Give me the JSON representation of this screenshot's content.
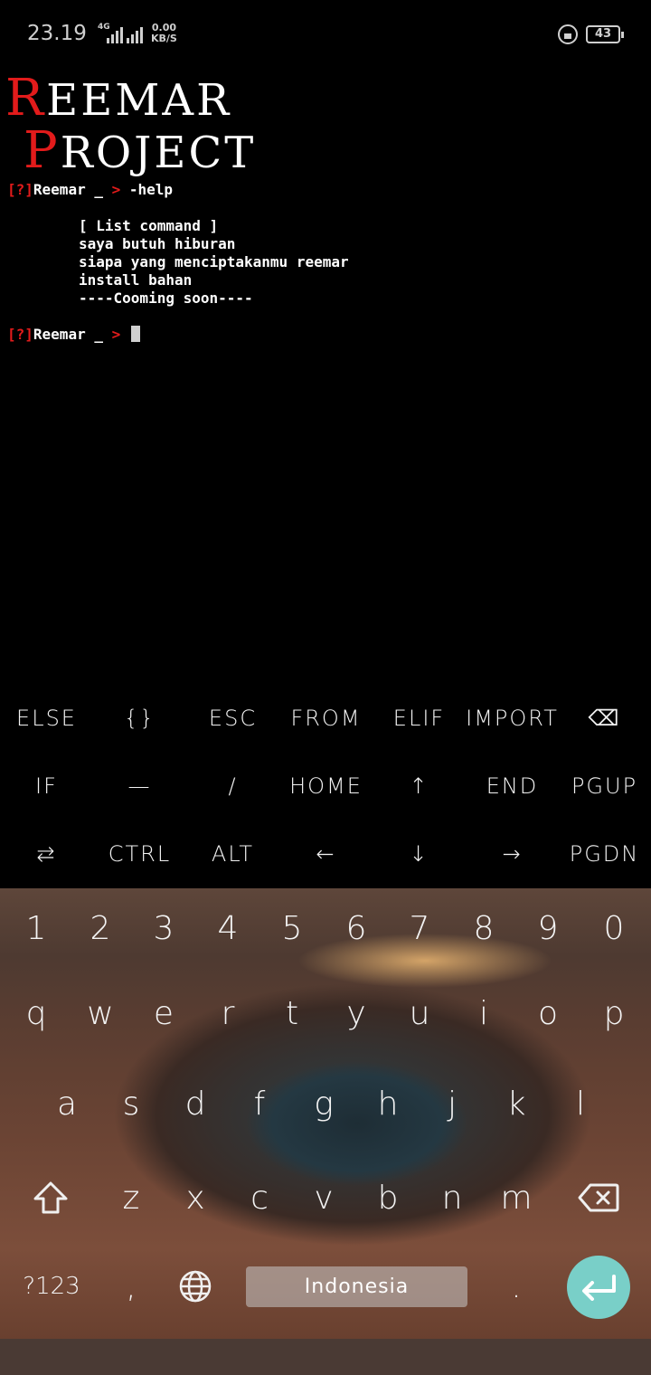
{
  "status_bar": {
    "time": "23.19",
    "network": "4G",
    "speed_value": "0.00",
    "speed_unit": "KB/S",
    "battery": "43"
  },
  "terminal": {
    "banner_line1_first": "R",
    "banner_line1_rest": "EEMAR",
    "banner_line2_first": "P",
    "banner_line2_rest": "ROJECT",
    "prompt_bracket": "[?]",
    "prompt_name": "Reemar _",
    "prompt_arrow": ">",
    "command1": " -help",
    "help_lines": [
      "[ List command ]",
      "saya butuh hiburan",
      "siapa yang menciptakanmu reemar",
      "install bahan",
      "----Cooming soon----"
    ]
  },
  "extra_keys": {
    "row1": [
      "ELSE",
      "{}",
      "ESC",
      "FROM",
      "ELIF",
      "IMPORT",
      "⌫"
    ],
    "row2": [
      "IF",
      "—",
      "/",
      "HOME",
      "↑",
      "END",
      "PGUP"
    ],
    "row3": [
      "⇆",
      "CTRL",
      "ALT",
      "←",
      "↓",
      "→",
      "PGDN"
    ]
  },
  "keyboard": {
    "numbers": [
      "1",
      "2",
      "3",
      "4",
      "5",
      "6",
      "7",
      "8",
      "9",
      "0"
    ],
    "row1": [
      "q",
      "w",
      "e",
      "r",
      "t",
      "y",
      "u",
      "i",
      "o",
      "p"
    ],
    "row2": [
      "a",
      "s",
      "d",
      "f",
      "g",
      "h",
      "j",
      "k",
      "l"
    ],
    "row3": [
      "z",
      "x",
      "c",
      "v",
      "b",
      "n",
      "m"
    ],
    "symbols_key": "?123",
    "comma": ",",
    "period": ".",
    "space_label": "Indonesia"
  },
  "colors": {
    "prompt_red": "#e21b1b",
    "enter_key": "#79cfc8"
  }
}
